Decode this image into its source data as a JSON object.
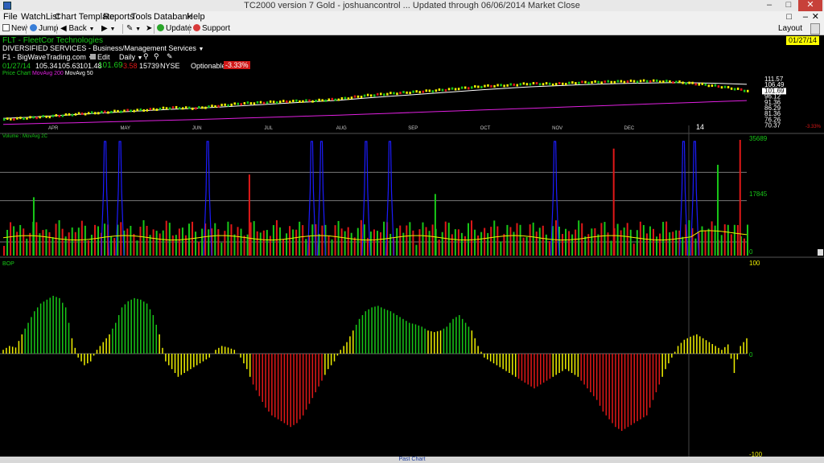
{
  "window": {
    "title": "TC2000 version 7 Gold - joshuancontrol ... Updated through 06/06/2014  Market Close"
  },
  "menu": [
    "File",
    "WatchList",
    "Chart Template",
    "Reports",
    "Tools",
    "Databank",
    "Help"
  ],
  "toolbar": {
    "new": "New",
    "jump": "Jump",
    "back": "Back",
    "update": "Update",
    "support": "Support",
    "layout": "Layout"
  },
  "symbol": {
    "name": "FLT - FleetCor Technologies",
    "sector": "DIVERSIFIED SERVICES - Business/Management Services",
    "watchlist": "F1 - BigWaveTrading.com",
    "edit": "Edit",
    "period": "Daily",
    "date": "01/27/14",
    "open": "105.34",
    "high": "105.63",
    "low": "101.48",
    "close": "101.69",
    "change": "-3.58",
    "volume": "15739",
    "exchange": "NYSE",
    "optionable": "Optionable",
    "pct_change": "-3.33%",
    "top_date": "01/27/14"
  },
  "legends": {
    "price": [
      "Price Chart",
      "MovAvg 200",
      "MovAvg 50"
    ],
    "volume": [
      "Volume",
      "MovAvg 2C"
    ],
    "bop": "BOP"
  },
  "colors": {
    "green": "#18c818",
    "red": "#e01818",
    "yellow": "#f0f000",
    "blue": "#1c1cff",
    "magenta": "#e020e0",
    "white": "#ffffff"
  },
  "footer": {
    "label": "Past Chart"
  },
  "chart_data": [
    {
      "type": "line",
      "title": "FLT - FleetCor Technologies",
      "x": [
        "APR",
        "MAY",
        "JUN",
        "JUL",
        "AUG",
        "SEP",
        "OCT",
        "NOV",
        "DEC",
        "14"
      ],
      "series_note": "price candles with MovAvg 200 and MovAvg 50",
      "price_y_labels": [
        "111.57",
        "106.49",
        "101.69",
        "96.12",
        "91.36",
        "86.29",
        "81.36",
        "76.26",
        "70.37"
      ],
      "price_path": [
        75,
        76.5,
        78,
        80,
        81.5,
        83,
        84,
        86,
        85.5,
        88,
        90,
        91,
        92,
        92.5,
        94,
        97,
        99,
        100.5,
        102,
        104,
        106,
        107,
        108.5,
        108,
        109.5,
        110,
        110.5,
        111,
        110,
        108,
        105.34,
        101.69
      ],
      "ma50_path": [
        76,
        77,
        78.3,
        79.6,
        80.9,
        82.2,
        83.4,
        84.5,
        85.5,
        86.6,
        87.9,
        89.2,
        90.5,
        91.7,
        93,
        94.8,
        96.5,
        98,
        99.6,
        101.2,
        102.8,
        104.2,
        105.5,
        106.5,
        107.4,
        108.1,
        108.7,
        109.1,
        109.4,
        109.2,
        108.6,
        107.8
      ],
      "ma200_path": [
        70.5,
        71,
        71.5,
        72,
        72.6,
        73.2,
        73.8,
        74.4,
        75,
        75.6,
        76.3,
        77,
        77.7,
        78.4,
        79.1,
        79.9,
        80.7,
        81.5,
        82.3,
        83.1,
        83.9,
        84.7,
        85.5,
        86.3,
        87.1,
        87.9,
        88.7,
        89.5,
        90.3,
        91.1,
        91.9,
        92.7
      ],
      "ylim": [
        68,
        116
      ]
    },
    {
      "type": "bar",
      "title": "Volume",
      "y_labels": [
        "35689",
        "17845",
        "0"
      ],
      "ylim": [
        0,
        35689
      ],
      "blue_spikes_x": [
        0.137,
        0.157,
        0.275,
        0.415,
        0.428,
        0.488,
        0.52,
        0.742,
        0.915,
        0.93
      ],
      "tall_bars": [
        [
          0.04,
          18000
        ],
        [
          0.33,
          25000
        ],
        [
          0.58,
          19000
        ],
        [
          0.82,
          33000
        ],
        [
          0.96,
          28000
        ],
        [
          0.99,
          35689
        ]
      ]
    },
    {
      "type": "bar",
      "title": "BOP",
      "y_labels": [
        "100",
        "0",
        "-100"
      ],
      "ylim": [
        -100,
        100
      ],
      "values": [
        5,
        10,
        8,
        25,
        40,
        55,
        65,
        70,
        75,
        72,
        60,
        20,
        -5,
        -15,
        -10,
        5,
        15,
        25,
        40,
        60,
        68,
        72,
        70,
        65,
        50,
        25,
        -10,
        -20,
        -30,
        -25,
        -20,
        -15,
        -10,
        -5,
        5,
        10,
        8,
        5,
        -5,
        -20,
        -40,
        -55,
        -70,
        -80,
        -85,
        -90,
        -95,
        -90,
        -80,
        -65,
        -50,
        -35,
        -20,
        -10,
        5,
        15,
        30,
        45,
        55,
        60,
        62,
        58,
        55,
        50,
        45,
        40,
        38,
        35,
        30,
        28,
        30,
        35,
        45,
        50,
        40,
        30,
        10,
        -5,
        -10,
        -15,
        -20,
        -25,
        -30,
        -35,
        -40,
        -45,
        -40,
        -35,
        -30,
        -25,
        -20,
        -25,
        -30,
        -40,
        -50,
        -60,
        -75,
        -85,
        -95,
        -100,
        -95,
        -90,
        -85,
        -80,
        -60,
        -40,
        -20,
        -5,
        10,
        18,
        22,
        25,
        20,
        15,
        10,
        5,
        12,
        -25,
        10,
        20
      ]
    }
  ]
}
